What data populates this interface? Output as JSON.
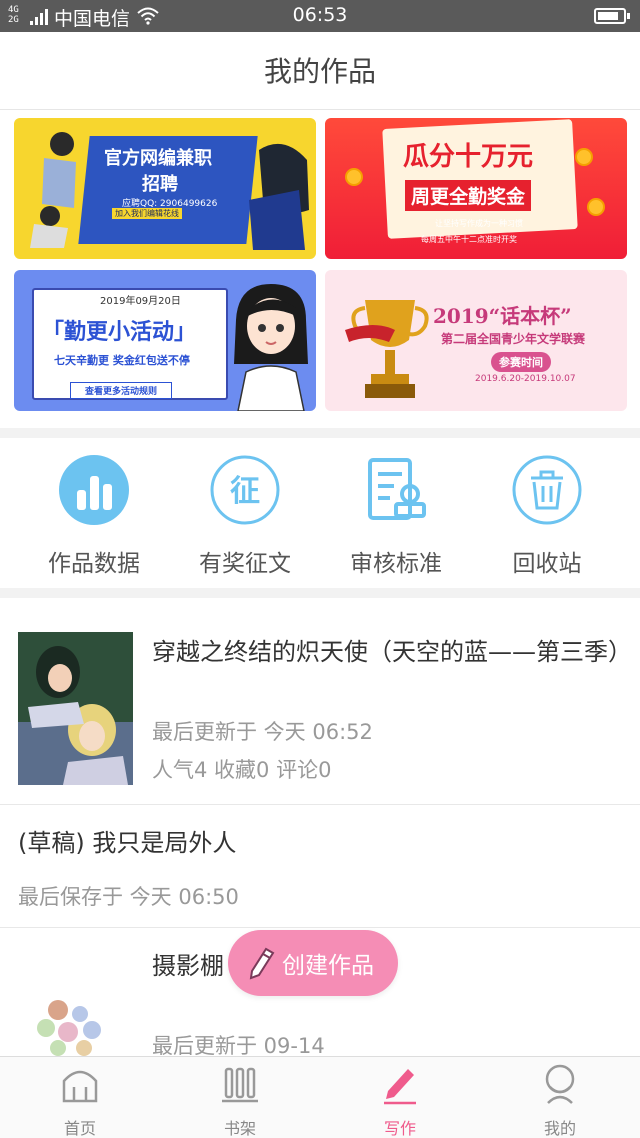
{
  "status_bar": {
    "network": "4G 2G",
    "carrier": "中国电信",
    "time": "06:53",
    "battery_level": 0.85
  },
  "header": {
    "title": "我的作品"
  },
  "banners": [
    {
      "id": "b1",
      "lines": [
        "官方网编兼职",
        "招聘",
        "应聘QQ: 2906499626",
        "加入我们编辑花线"
      ]
    },
    {
      "id": "b2",
      "lines": [
        "瓜分十万元",
        "周更全勤奖金",
        "让坚持写作成为一种习惯",
        "每周五中午十二点准时开奖"
      ]
    },
    {
      "id": "b3",
      "lines": [
        "2019年09月20日",
        "「勤更小活动」",
        "七天辛勤更 奖金红包送不停",
        "查看更多活动规则"
      ]
    },
    {
      "id": "b4",
      "lines": [
        "2019“话本杯”",
        "第二届全国青少年文学联赛",
        "参赛时间",
        "2019.6.20-2019.10.07"
      ]
    }
  ],
  "actions": [
    {
      "label": "作品数据",
      "icon": "chart-icon"
    },
    {
      "label": "有奖征文",
      "icon": "contest-icon"
    },
    {
      "label": "审核标准",
      "icon": "review-standard-icon"
    },
    {
      "label": "回收站",
      "icon": "trash-icon"
    }
  ],
  "works": [
    {
      "title": "穿越之终结的炽天使（天空的蓝——第三季）",
      "updated": "最后更新于 今天 06:52",
      "stats": "人气4 收藏0 评论0"
    },
    {
      "title": "(草稿) 我只是局外人",
      "updated": "最后保存于 今天 06:50"
    },
    {
      "title": "摄影棚",
      "updated": "最后更新于 09-14"
    }
  ],
  "fab": {
    "label": "创建作品",
    "icon": "pencil-icon"
  },
  "tabbar": [
    {
      "label": "首页",
      "icon": "home-icon",
      "active": false
    },
    {
      "label": "书架",
      "icon": "bookshelf-icon",
      "active": false
    },
    {
      "label": "写作",
      "icon": "write-icon",
      "active": true
    },
    {
      "label": "我的",
      "icon": "profile-icon",
      "active": false
    }
  ],
  "colors": {
    "accent": "#ef5b8c",
    "icon_blue": "#6cc3f0",
    "fab": "#f58db5"
  }
}
